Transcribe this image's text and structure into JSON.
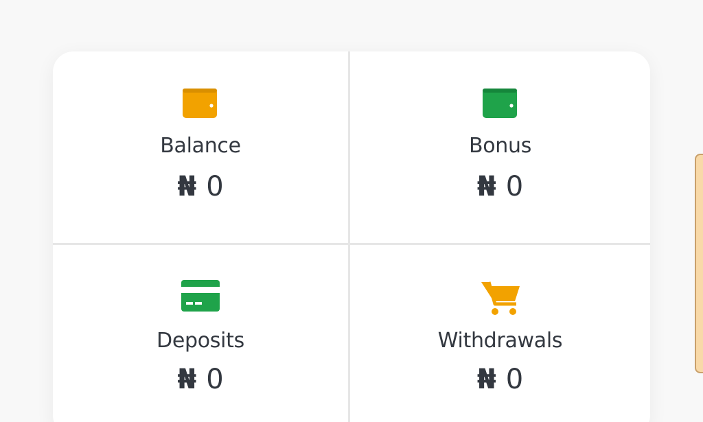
{
  "cards": [
    {
      "label": "Balance",
      "currency": "₦",
      "amount": "0",
      "icon": "wallet-icon",
      "color": "#f2a200"
    },
    {
      "label": "Bonus",
      "currency": "₦",
      "amount": "0",
      "icon": "wallet-icon",
      "color": "#1fa34a"
    },
    {
      "label": "Deposits",
      "currency": "₦",
      "amount": "0",
      "icon": "credit-card-icon",
      "color": "#1fa34a"
    },
    {
      "label": "Withdrawals",
      "currency": "₦",
      "amount": "0",
      "icon": "shopping-cart-icon",
      "color": "#f2a200"
    }
  ]
}
